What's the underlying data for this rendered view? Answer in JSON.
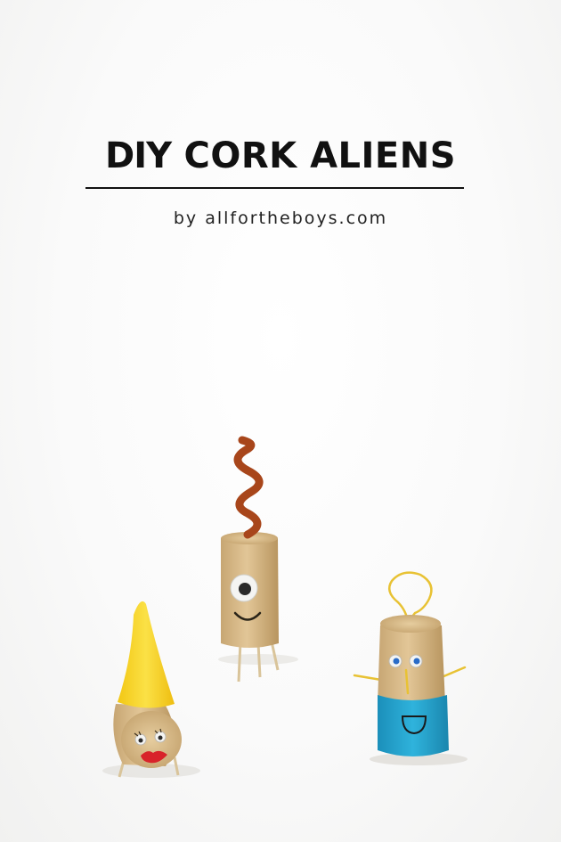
{
  "header": {
    "title_bold": "DIY",
    "title_rest": "CORK ALIENS",
    "byline": "by allfortheboys.com"
  },
  "scene": {
    "background": "#ffffff",
    "aliens": [
      {
        "name": "yellow-hat-alien",
        "hat_color": "#f6d21c",
        "lips_color": "#d8232a"
      },
      {
        "name": "cyclops-alien",
        "antenna_color": "#a8461b"
      },
      {
        "name": "blue-shirt-alien",
        "shirt_color": "#23a3cf",
        "antenna_color": "#e8c234"
      }
    ]
  }
}
